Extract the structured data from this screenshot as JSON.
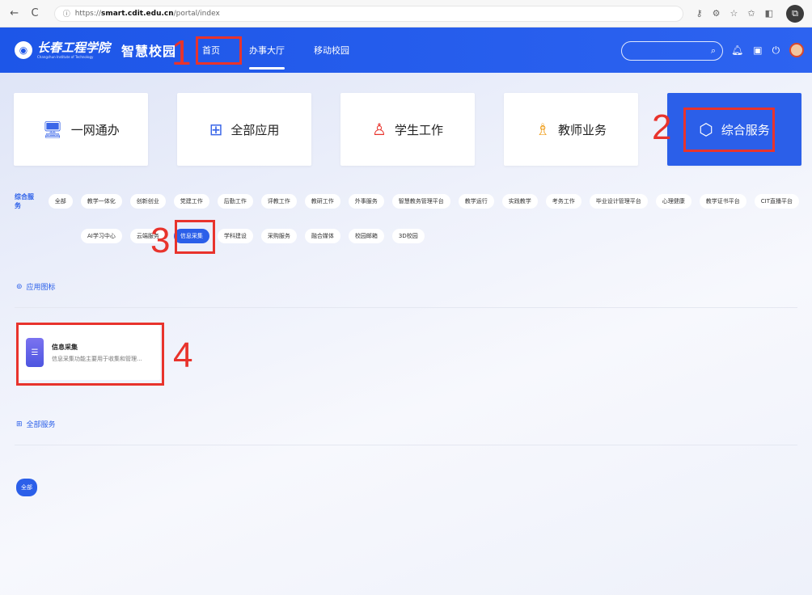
{
  "browser": {
    "back_icon": "arrow-left-icon",
    "reload_icon": "reload-icon",
    "url_prefix": "https://",
    "url_host": "smart.cdit.edu.cn",
    "url_path": "/portal/index"
  },
  "header": {
    "logo_text": "长春工程学院",
    "logo_en": "Changchun Institute of Technology",
    "brand": "智慧校园",
    "nav": [
      {
        "label": "首页"
      },
      {
        "label": "办事大厅"
      },
      {
        "label": "移动校园"
      }
    ]
  },
  "cards": [
    {
      "label": "一网通办",
      "icon": "monitor-icon"
    },
    {
      "label": "全部应用",
      "icon": "grid-icon"
    },
    {
      "label": "学生工作",
      "icon": "student-icon"
    },
    {
      "label": "教师业务",
      "icon": "teacher-icon"
    },
    {
      "label": "综合服务",
      "icon": "settings-hex-icon"
    }
  ],
  "tags": {
    "label": "综合服务",
    "row1": [
      "全部",
      "教学一体化",
      "创新创业",
      "党建工作",
      "后勤工作",
      "评教工作",
      "教研工作",
      "外事服务",
      "智慧教务管理平台",
      "教学运行",
      "实践教学",
      "考务工作",
      "毕业设计管理平台",
      "心理健康",
      "教学证书平台",
      "CIT直播平台"
    ],
    "row2": [
      "AI学习中心",
      "云端服务",
      "信息采集",
      "学科建设",
      "采购服务",
      "融合媒体",
      "校园邮箱",
      "3D校园"
    ]
  },
  "sections": {
    "apps_heading": "应用图标",
    "all_heading": "全部服务",
    "all_button": "全部"
  },
  "app_card": {
    "title": "信息采集",
    "desc": "信息采集功能主要用于收集和管理..."
  },
  "annotations": [
    "1",
    "2",
    "3",
    "4"
  ],
  "colors": {
    "primary": "#2b5fe9",
    "annotation": "#e8332c"
  }
}
